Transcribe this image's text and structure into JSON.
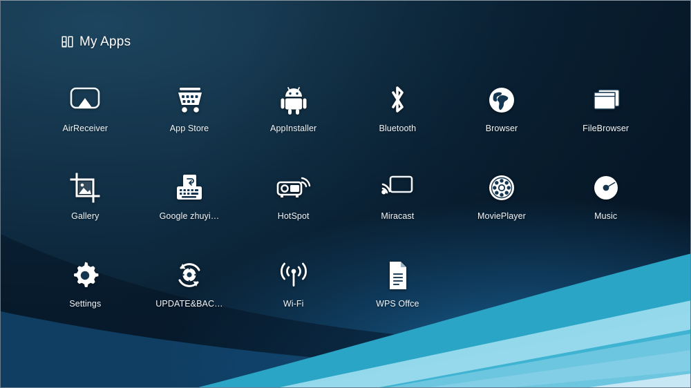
{
  "window": {
    "background_top_left": "#1d455f",
    "background_top_right": "#071a2b",
    "accent_wave_cyan": "#29a8c9",
    "accent_wave_light": "#8fd4e8",
    "accent_blue": "#1d70a8"
  },
  "header": {
    "title": "My Apps",
    "icon": "apps-grid-icon"
  },
  "apps": [
    {
      "label": "AirReceiver",
      "icon": "airplay-icon"
    },
    {
      "label": "App Store",
      "icon": "shopping-cart-icon"
    },
    {
      "label": "AppInstaller",
      "icon": "android-robot-icon"
    },
    {
      "label": "Bluetooth",
      "icon": "bluetooth-icon"
    },
    {
      "label": "Browser",
      "icon": "globe-icon"
    },
    {
      "label": "FileBrowser",
      "icon": "windows-stack-icon"
    },
    {
      "label": "Gallery",
      "icon": "photo-crop-icon"
    },
    {
      "label": "Google zhuyi…",
      "icon": "keyboard-ime-icon"
    },
    {
      "label": "HotSpot",
      "icon": "projector-signal-icon"
    },
    {
      "label": "Miracast",
      "icon": "screen-cast-icon"
    },
    {
      "label": "MoviePlayer",
      "icon": "film-reel-icon"
    },
    {
      "label": "Music",
      "icon": "vinyl-disc-icon"
    },
    {
      "label": "Settings",
      "icon": "gear-icon"
    },
    {
      "label": "UPDATE&BAC…",
      "icon": "update-refresh-gear-icon"
    },
    {
      "label": "Wi-Fi",
      "icon": "wifi-antenna-icon"
    },
    {
      "label": "WPS Offce",
      "icon": "document-page-icon"
    }
  ]
}
